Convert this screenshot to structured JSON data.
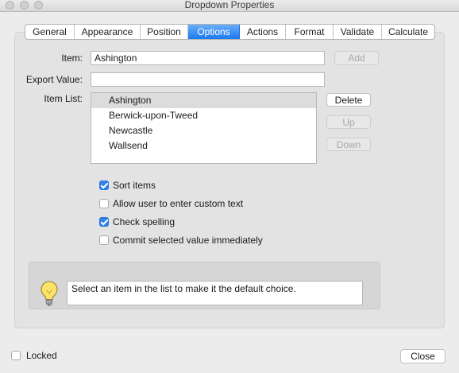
{
  "window": {
    "title": "Dropdown Properties"
  },
  "tabs": [
    {
      "label": "General",
      "active": false
    },
    {
      "label": "Appearance",
      "active": false
    },
    {
      "label": "Position",
      "active": false
    },
    {
      "label": "Options",
      "active": true
    },
    {
      "label": "Actions",
      "active": false
    },
    {
      "label": "Format",
      "active": false
    },
    {
      "label": "Validate",
      "active": false
    },
    {
      "label": "Calculate",
      "active": false
    }
  ],
  "form": {
    "item_label": "Item:",
    "item_value": "Ashington",
    "add_button": "Add",
    "export_label": "Export Value:",
    "export_value": "",
    "item_list_label": "Item List:",
    "item_list": [
      "Ashington",
      "Berwick-upon-Tweed",
      "Newcastle",
      "Wallsend"
    ],
    "selected_item": "Ashington",
    "delete_button": "Delete",
    "up_button": "Up",
    "down_button": "Down"
  },
  "options": [
    {
      "label": "Sort items",
      "checked": true
    },
    {
      "label": "Allow user to enter custom text",
      "checked": false
    },
    {
      "label": "Check spelling",
      "checked": true
    },
    {
      "label": "Commit selected value immediately",
      "checked": false
    }
  ],
  "hint": {
    "icon": "lightbulb-icon",
    "text": "Select an item in the list to make it the default choice."
  },
  "footer": {
    "locked_label": "Locked",
    "locked_checked": false,
    "close_button": "Close"
  },
  "colors": {
    "accent": "#1b79f0",
    "background": "#ececec"
  }
}
